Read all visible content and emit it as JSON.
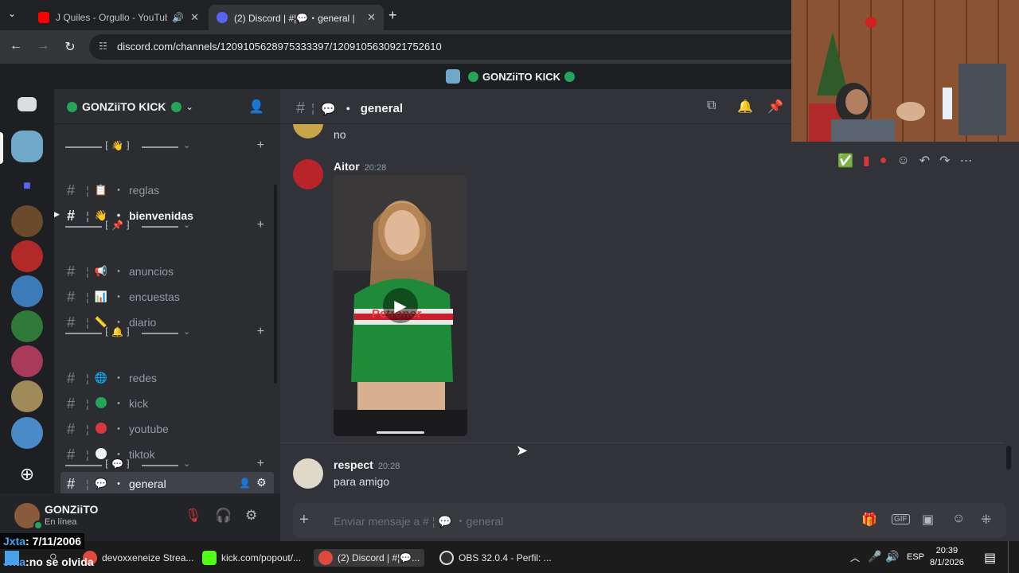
{
  "browser": {
    "tabs": [
      {
        "title": "J Quiles - Orgullo - YouTube",
        "active": false
      },
      {
        "title": "(2) Discord | #¦💬・general |",
        "active": true
      }
    ],
    "url": "discord.com/channels/1209105628975333397/1209105630921752610"
  },
  "discord": {
    "window_title": "GONZiiTO KICK",
    "guild_name": "GONZiiTO KICK",
    "categories": [
      {
        "icon": "👋"
      },
      {
        "icon": "📌"
      },
      {
        "icon": "🔔"
      },
      {
        "icon": "💬"
      }
    ],
    "channels": [
      {
        "emoji": "📋",
        "name": "reglas"
      },
      {
        "emoji": "👋",
        "name": "bienvenidas"
      },
      {
        "emoji": "📢",
        "name": "anuncios"
      },
      {
        "emoji": "📊",
        "name": "encuestas"
      },
      {
        "emoji": "📏",
        "name": "diario"
      },
      {
        "emoji": "🌐",
        "name": "redes"
      },
      {
        "emoji": "",
        "name": "kick"
      },
      {
        "emoji": "",
        "name": "youtube"
      },
      {
        "emoji": "",
        "name": "tiktok"
      },
      {
        "emoji": "💬",
        "name": "general"
      }
    ],
    "user": {
      "name": "GONZiiTO",
      "status": "En línea"
    },
    "chat_header": {
      "channel": "general",
      "emoji": "💬"
    },
    "messages": [
      {
        "author": "",
        "time": "",
        "text": "no"
      },
      {
        "author": "Aitor",
        "time": "20:28",
        "text": ""
      },
      {
        "author": "respect",
        "time": "20:28",
        "text": "para amigo"
      }
    ],
    "video_overlay_text": "Petronor",
    "composer_placeholder": "Enviar mensaje a # ¦ 💬 ・general",
    "colors": {
      "accent": "#5865f2",
      "online": "#23a55a",
      "bg": "#313338"
    }
  },
  "overlays": {
    "line1_name": "Jxta",
    "line1_text": ": 7/11/2006",
    "line2_name": "Jxta",
    "line2_text": ":no se olvida"
  },
  "taskbar": {
    "items": [
      {
        "label": "devoxxeneize Strea..."
      },
      {
        "label": "kick.com/popout/..."
      },
      {
        "label": "(2) Discord | #¦💬..."
      },
      {
        "label": "OBS 32.0.4 - Perfil: ..."
      }
    ],
    "lang": "ESP",
    "time": "20:39",
    "date": "8/1/2026"
  }
}
